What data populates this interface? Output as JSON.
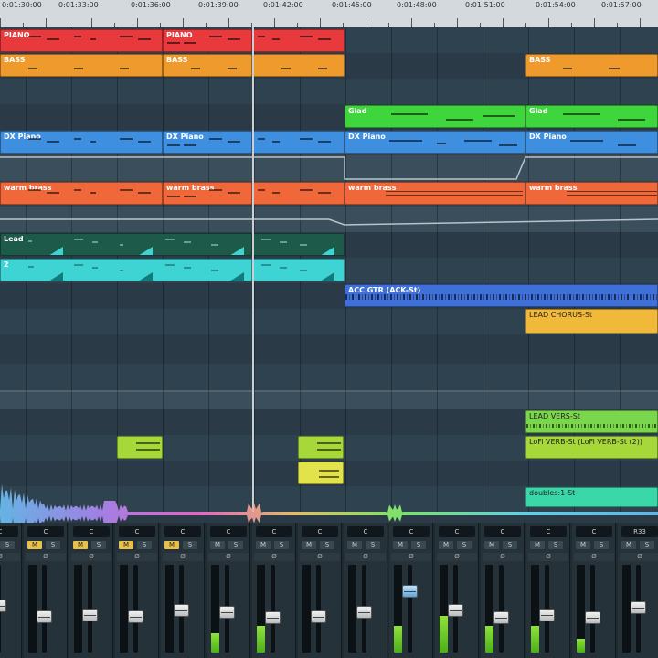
{
  "ruler": {
    "labels": [
      "0:01:30:00",
      "0:01:33:00",
      "0:01:36:00",
      "0:01:39:00",
      "0:01:42:00",
      "0:01:45:00",
      "0:01:48:00",
      "0:01:51:00",
      "0:01:54:00",
      "0:01:57:00"
    ]
  },
  "tracks": [
    {
      "name": "piano",
      "clips": [
        {
          "label": "PIANO",
          "type": "midi",
          "color": "#e8393c"
        },
        {
          "label": "PIANO",
          "type": "midi",
          "color": "#e8393c"
        },
        {
          "label": "",
          "type": "midi",
          "color": "#e8393c"
        }
      ]
    },
    {
      "name": "bass",
      "clips": [
        {
          "label": "BASS",
          "type": "midi",
          "color": "#ef9a2c"
        },
        {
          "label": "BASS",
          "type": "midi",
          "color": "#ef9a2c"
        },
        {
          "label": "",
          "type": "midi",
          "color": "#ef9a2c"
        },
        {
          "label": "BASS",
          "type": "midi",
          "color": "#ef9a2c"
        }
      ]
    },
    {
      "name": "glad",
      "clips": [
        {
          "label": "Glad",
          "type": "midi",
          "color": "#3ed63c"
        },
        {
          "label": "Glad",
          "type": "midi",
          "color": "#3ed63c"
        }
      ]
    },
    {
      "name": "dx-piano",
      "clips": [
        {
          "label": "DX Piano",
          "type": "midi",
          "color": "#3f8fe0"
        },
        {
          "label": "DX Piano",
          "type": "midi",
          "color": "#3f8fe0"
        },
        {
          "label": "",
          "type": "midi",
          "color": "#3f8fe0"
        },
        {
          "label": "DX Piano",
          "type": "midi",
          "color": "#3f8fe0"
        },
        {
          "label": "DX Piano",
          "type": "midi",
          "color": "#3f8fe0"
        }
      ]
    },
    {
      "name": "warm-brass",
      "clips": [
        {
          "label": "warm brass",
          "type": "midi",
          "color": "#f0683a"
        },
        {
          "label": "warm brass",
          "type": "midi",
          "color": "#f0683a"
        },
        {
          "label": "",
          "type": "midi",
          "color": "#f0683a"
        },
        {
          "label": "warm brass",
          "type": "midi",
          "color": "#f0683a"
        },
        {
          "label": "warm brass",
          "type": "midi",
          "color": "#f0683a"
        }
      ]
    },
    {
      "name": "lead",
      "clips": [
        {
          "label": "Lead",
          "type": "midi",
          "color": "#1d5a4a"
        },
        {
          "label": "",
          "type": "midi",
          "color": "#1d5a4a"
        }
      ]
    },
    {
      "name": "lead-2",
      "clips": [
        {
          "label": "2",
          "type": "midi",
          "color": "#3ed4d4"
        },
        {
          "label": "",
          "type": "midi",
          "color": "#3ed4d4"
        }
      ]
    },
    {
      "name": "acc-gtr",
      "clips": [
        {
          "label": "ACC GTR (ACK-St)",
          "type": "audio",
          "color": "#3f6fd8"
        }
      ]
    },
    {
      "name": "lead-chorus",
      "clips": [
        {
          "label": "LEAD CHORUS-St",
          "type": "audio",
          "color": "#f0b93a"
        }
      ]
    },
    {
      "name": "lead-vers",
      "clips": [
        {
          "label": "LEAD VERS-St",
          "type": "audio",
          "color": "#7ad64a"
        }
      ]
    },
    {
      "name": "lofi-verb",
      "clips": [
        {
          "label": "LoFi VERB-St (LoFi VERB-St (2))",
          "type": "audio",
          "color": "#a6d83a"
        }
      ]
    },
    {
      "name": "doubles",
      "clips": [
        {
          "label": "doubles:1-St",
          "type": "audio",
          "color": "#3ad8a8"
        }
      ]
    }
  ],
  "mixer": {
    "channels": [
      {
        "pan": "C",
        "mute_label": "M",
        "solo_label": "S",
        "mute": false
      },
      {
        "pan": "C",
        "mute_label": "M",
        "solo_label": "S",
        "mute": true
      },
      {
        "pan": "C",
        "mute_label": "M",
        "solo_label": "S",
        "mute": true
      },
      {
        "pan": "C",
        "mute_label": "M",
        "solo_label": "S",
        "mute": true
      },
      {
        "pan": "C",
        "mute_label": "M",
        "solo_label": "S",
        "mute": true
      },
      {
        "pan": "C",
        "mute_label": "M",
        "solo_label": "S",
        "mute": false
      },
      {
        "pan": "C",
        "mute_label": "M",
        "solo_label": "S",
        "mute": false
      },
      {
        "pan": "C",
        "mute_label": "M",
        "solo_label": "S",
        "mute": false
      },
      {
        "pan": "C",
        "mute_label": "M",
        "solo_label": "S",
        "mute": false
      },
      {
        "pan": "C",
        "mute_label": "M",
        "solo_label": "S",
        "mute": false
      },
      {
        "pan": "C",
        "mute_label": "M",
        "solo_label": "S",
        "mute": false
      },
      {
        "pan": "C",
        "mute_label": "M",
        "solo_label": "S",
        "mute": false
      },
      {
        "pan": "C",
        "mute_label": "M",
        "solo_label": "S",
        "mute": false
      },
      {
        "pan": "C",
        "mute_label": "M",
        "solo_label": "S",
        "mute": false
      },
      {
        "pan": "R33",
        "mute_label": "M",
        "solo_label": "S",
        "mute": false
      }
    ],
    "phase_symbol": "Ø",
    "fader_levels": [
      0.52,
      0.38,
      0.4,
      0.38,
      0.46,
      0.44,
      0.36,
      0.38,
      0.44,
      0.72,
      0.46,
      0.36,
      0.4,
      0.36,
      0.5
    ],
    "meter_levels": [
      0,
      0,
      0,
      0,
      0,
      0.22,
      0.3,
      0,
      0,
      0.3,
      0.42,
      0.3,
      0.3,
      0.16,
      0
    ]
  }
}
